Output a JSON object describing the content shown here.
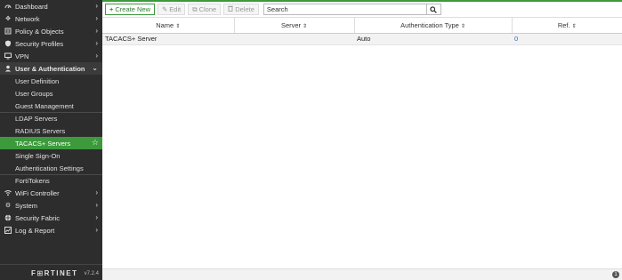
{
  "sidebar": {
    "items": [
      {
        "label": "Dashboard",
        "icon": "dashboard-icon"
      },
      {
        "label": "Network",
        "icon": "network-icon"
      },
      {
        "label": "Policy & Objects",
        "icon": "policy-icon"
      },
      {
        "label": "Security Profiles",
        "icon": "shield-icon"
      },
      {
        "label": "VPN",
        "icon": "monitor-icon"
      },
      {
        "label": "User & Authentication",
        "icon": "user-icon"
      }
    ],
    "sub_items": [
      "User Definition",
      "User Groups",
      "Guest Management",
      "LDAP Servers",
      "RADIUS Servers",
      "TACACS+ Servers",
      "Single Sign-On",
      "Authentication Settings",
      "FortiTokens"
    ],
    "items_after": [
      {
        "label": "WiFi Controller",
        "icon": "wifi-icon"
      },
      {
        "label": "System",
        "icon": "gear-icon"
      },
      {
        "label": "Security Fabric",
        "icon": "fabric-icon"
      },
      {
        "label": "Log & Report",
        "icon": "chart-icon"
      }
    ],
    "brand": "F⊞RTINET",
    "version": "v7.2.4"
  },
  "toolbar": {
    "create_new": "Create New",
    "edit": "Edit",
    "clone": "Clone",
    "delete": "Delete",
    "search_placeholder": "Search"
  },
  "table": {
    "columns": [
      "Name",
      "Server",
      "Authentication Type",
      "Ref."
    ],
    "rows": [
      {
        "name": "TACACS+ Server",
        "server": "",
        "auth_type": "Auto",
        "ref": "0"
      }
    ]
  },
  "status": {
    "count": "1"
  },
  "colors": {
    "accent": "#3c9a3c",
    "sidebar_bg": "#2d2d2d",
    "link": "#2b6cb0"
  }
}
